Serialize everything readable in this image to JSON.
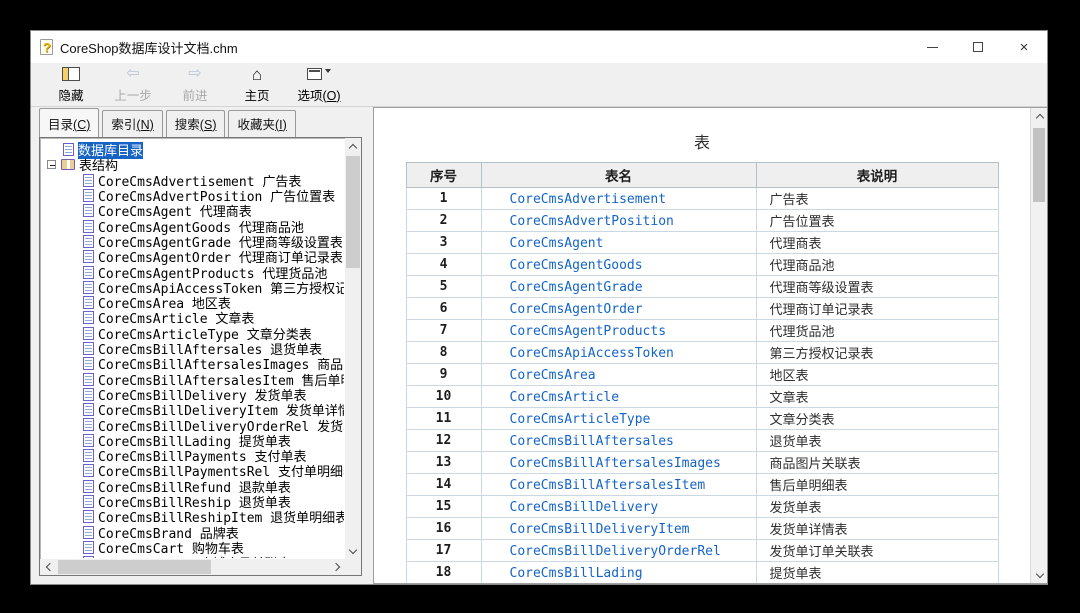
{
  "window": {
    "title": "CoreShop数据库设计文档.chm"
  },
  "icons": {
    "back": "⇦",
    "forward": "⇨",
    "home": "⌂"
  },
  "toolbar": {
    "buttons": [
      {
        "label": "隐藏",
        "enabled": true
      },
      {
        "label": "上一步",
        "enabled": false
      },
      {
        "label": "前进",
        "enabled": false
      },
      {
        "label": "主页",
        "enabled": true
      },
      {
        "label": "选项",
        "key": "O",
        "enabled": true
      }
    ]
  },
  "sidebar": {
    "tabs": [
      {
        "text": "目录",
        "key": "C",
        "active": true
      },
      {
        "text": "索引",
        "key": "N",
        "active": false
      },
      {
        "text": "搜索",
        "key": "S",
        "active": false
      },
      {
        "text": "收藏夹",
        "key": "I",
        "active": false
      }
    ],
    "tree": {
      "root_label": "数据库目录",
      "group_label": "表结构",
      "items": [
        "CoreCmsAdvertisement 广告表",
        "CoreCmsAdvertPosition 广告位置表",
        "CoreCmsAgent 代理商表",
        "CoreCmsAgentGoods 代理商品池",
        "CoreCmsAgentGrade 代理商等级设置表",
        "CoreCmsAgentOrder 代理商订单记录表",
        "CoreCmsAgentProducts 代理货品池",
        "CoreCmsApiAccessToken 第三方授权记录表",
        "CoreCmsArea 地区表",
        "CoreCmsArticle 文章表",
        "CoreCmsArticleType 文章分类表",
        "CoreCmsBillAftersales 退货单表",
        "CoreCmsBillAftersalesImages 商品图片关联表",
        "CoreCmsBillAftersalesItem 售后单明细表",
        "CoreCmsBillDelivery 发货单表",
        "CoreCmsBillDeliveryItem 发货单详情表",
        "CoreCmsBillDeliveryOrderRel 发货单订单关联表",
        "CoreCmsBillLading 提货单表",
        "CoreCmsBillPayments 支付单表",
        "CoreCmsBillPaymentsRel 支付单明细表",
        "CoreCmsBillRefund 退款单表",
        "CoreCmsBillReship 退货单表",
        "CoreCmsBillReshipItem 退货单明细表",
        "CoreCmsBrand 品牌表",
        "CoreCmsCart 购物车表",
        "CoreCmsClerk 店铺店员关联表"
      ]
    }
  },
  "content": {
    "page_title": "表",
    "table": {
      "headers": [
        "序号",
        "表名",
        "表说明"
      ],
      "rows": [
        [
          "1",
          "CoreCmsAdvertisement",
          "广告表"
        ],
        [
          "2",
          "CoreCmsAdvertPosition",
          "广告位置表"
        ],
        [
          "3",
          "CoreCmsAgent",
          "代理商表"
        ],
        [
          "4",
          "CoreCmsAgentGoods",
          "代理商品池"
        ],
        [
          "5",
          "CoreCmsAgentGrade",
          "代理商等级设置表"
        ],
        [
          "6",
          "CoreCmsAgentOrder",
          "代理商订单记录表"
        ],
        [
          "7",
          "CoreCmsAgentProducts",
          "代理货品池"
        ],
        [
          "8",
          "CoreCmsApiAccessToken",
          "第三方授权记录表"
        ],
        [
          "9",
          "CoreCmsArea",
          "地区表"
        ],
        [
          "10",
          "CoreCmsArticle",
          "文章表"
        ],
        [
          "11",
          "CoreCmsArticleType",
          "文章分类表"
        ],
        [
          "12",
          "CoreCmsBillAftersales",
          "退货单表"
        ],
        [
          "13",
          "CoreCmsBillAftersalesImages",
          "商品图片关联表"
        ],
        [
          "14",
          "CoreCmsBillAftersalesItem",
          "售后单明细表"
        ],
        [
          "15",
          "CoreCmsBillDelivery",
          "发货单表"
        ],
        [
          "16",
          "CoreCmsBillDeliveryItem",
          "发货单详情表"
        ],
        [
          "17",
          "CoreCmsBillDeliveryOrderRel",
          "发货单订单关联表"
        ],
        [
          "18",
          "CoreCmsBillLading",
          "提货单表"
        ]
      ]
    }
  },
  "colors": {
    "link": "#1464C8",
    "selection": "#1763C6"
  }
}
